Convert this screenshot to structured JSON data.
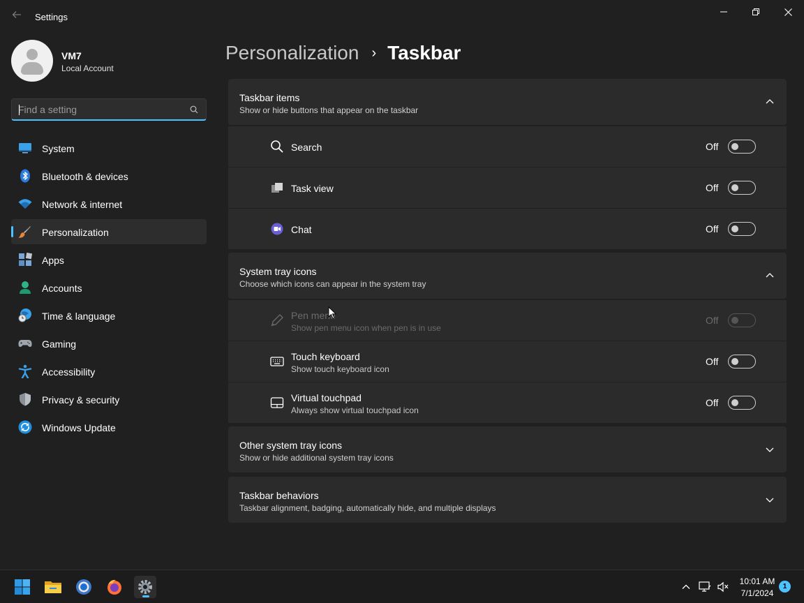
{
  "window": {
    "title": "Settings",
    "back_icon": "back-arrow-icon",
    "controls": [
      "minimize-icon",
      "restore-icon",
      "close-icon"
    ]
  },
  "profile": {
    "name": "VM7",
    "account_type": "Local Account"
  },
  "search": {
    "placeholder": "Find a setting",
    "icon": "search-icon"
  },
  "sidebar": {
    "items": [
      {
        "label": "System",
        "icon": "system-icon"
      },
      {
        "label": "Bluetooth & devices",
        "icon": "bluetooth-icon"
      },
      {
        "label": "Network & internet",
        "icon": "wifi-icon"
      },
      {
        "label": "Personalization",
        "icon": "brush-icon",
        "active": true
      },
      {
        "label": "Apps",
        "icon": "apps-icon"
      },
      {
        "label": "Accounts",
        "icon": "accounts-icon"
      },
      {
        "label": "Time & language",
        "icon": "time-language-icon"
      },
      {
        "label": "Gaming",
        "icon": "gamepad-icon"
      },
      {
        "label": "Accessibility",
        "icon": "accessibility-icon"
      },
      {
        "label": "Privacy & security",
        "icon": "shield-icon"
      },
      {
        "label": "Windows Update",
        "icon": "update-icon"
      }
    ]
  },
  "breadcrumb": {
    "parent": "Personalization",
    "separator": "›",
    "current": "Taskbar"
  },
  "sections": {
    "taskbar_items": {
      "title": "Taskbar items",
      "description": "Show or hide buttons that appear on the taskbar",
      "expanded": true,
      "rows": [
        {
          "title": "Search",
          "state": "Off",
          "icon": "search-icon"
        },
        {
          "title": "Task view",
          "state": "Off",
          "icon": "task-view-icon"
        },
        {
          "title": "Chat",
          "state": "Off",
          "icon": "chat-icon"
        }
      ]
    },
    "system_tray": {
      "title": "System tray icons",
      "description": "Choose which icons can appear in the system tray",
      "expanded": true,
      "rows": [
        {
          "title": "Pen menu",
          "description": "Show pen menu icon when pen is in use",
          "state": "Off",
          "icon": "pen-icon",
          "disabled": true
        },
        {
          "title": "Touch keyboard",
          "description": "Show touch keyboard icon",
          "state": "Off",
          "icon": "keyboard-icon"
        },
        {
          "title": "Virtual touchpad",
          "description": "Always show virtual touchpad icon",
          "state": "Off",
          "icon": "touchpad-icon"
        }
      ]
    },
    "other_tray": {
      "title": "Other system tray icons",
      "description": "Show or hide additional system tray icons",
      "expanded": false
    },
    "behaviors": {
      "title": "Taskbar behaviors",
      "description": "Taskbar alignment, badging, automatically hide, and multiple displays",
      "expanded": false
    }
  },
  "taskbar": {
    "apps": [
      "windows-start-icon",
      "file-explorer-icon",
      "chrome-icon",
      "firefox-icon",
      "settings-icon"
    ],
    "tray": [
      "chevron-up-icon",
      "network-monitor-icon",
      "volume-icon"
    ],
    "time": "10:01 AM",
    "date": "7/1/2024",
    "notification_count": "1"
  },
  "colors": {
    "background": "#202020",
    "card": "#2b2b2b",
    "accent": "#4cc2ff"
  }
}
